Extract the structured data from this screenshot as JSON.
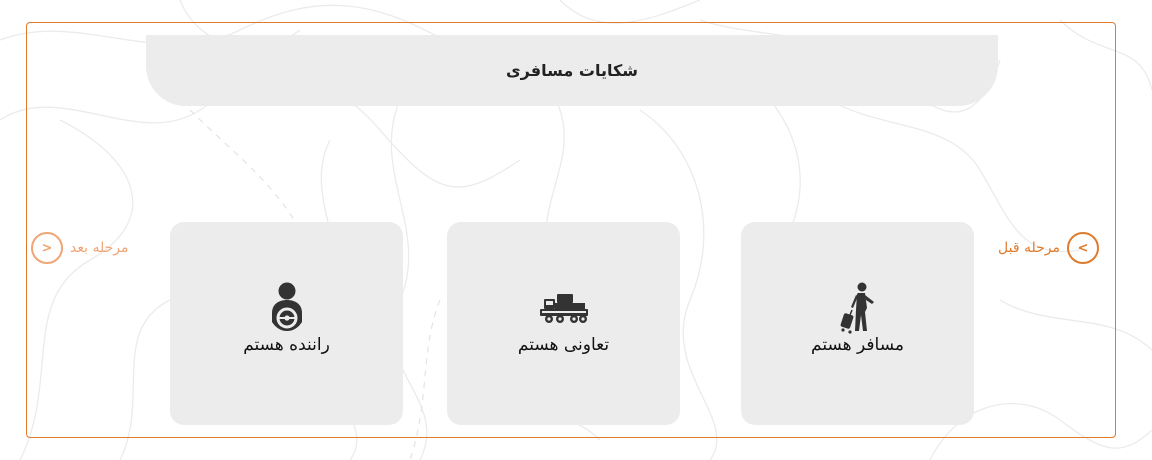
{
  "header": {
    "title": "شکایات مسافری"
  },
  "cards": [
    {
      "label": "مسافر هستم",
      "icon": "traveler-icon"
    },
    {
      "label": "تعاونی هستم",
      "icon": "truck-icon"
    },
    {
      "label": "راننده هستم",
      "icon": "driver-icon"
    }
  ],
  "nav": {
    "next_label": "مرحله بعد",
    "next_arrow": ">",
    "prev_label": "مرحله قبل",
    "prev_arrow": "<"
  },
  "colors": {
    "accent": "#e07b2e",
    "accent_light": "#f0a574",
    "card_bg": "#ececec"
  }
}
